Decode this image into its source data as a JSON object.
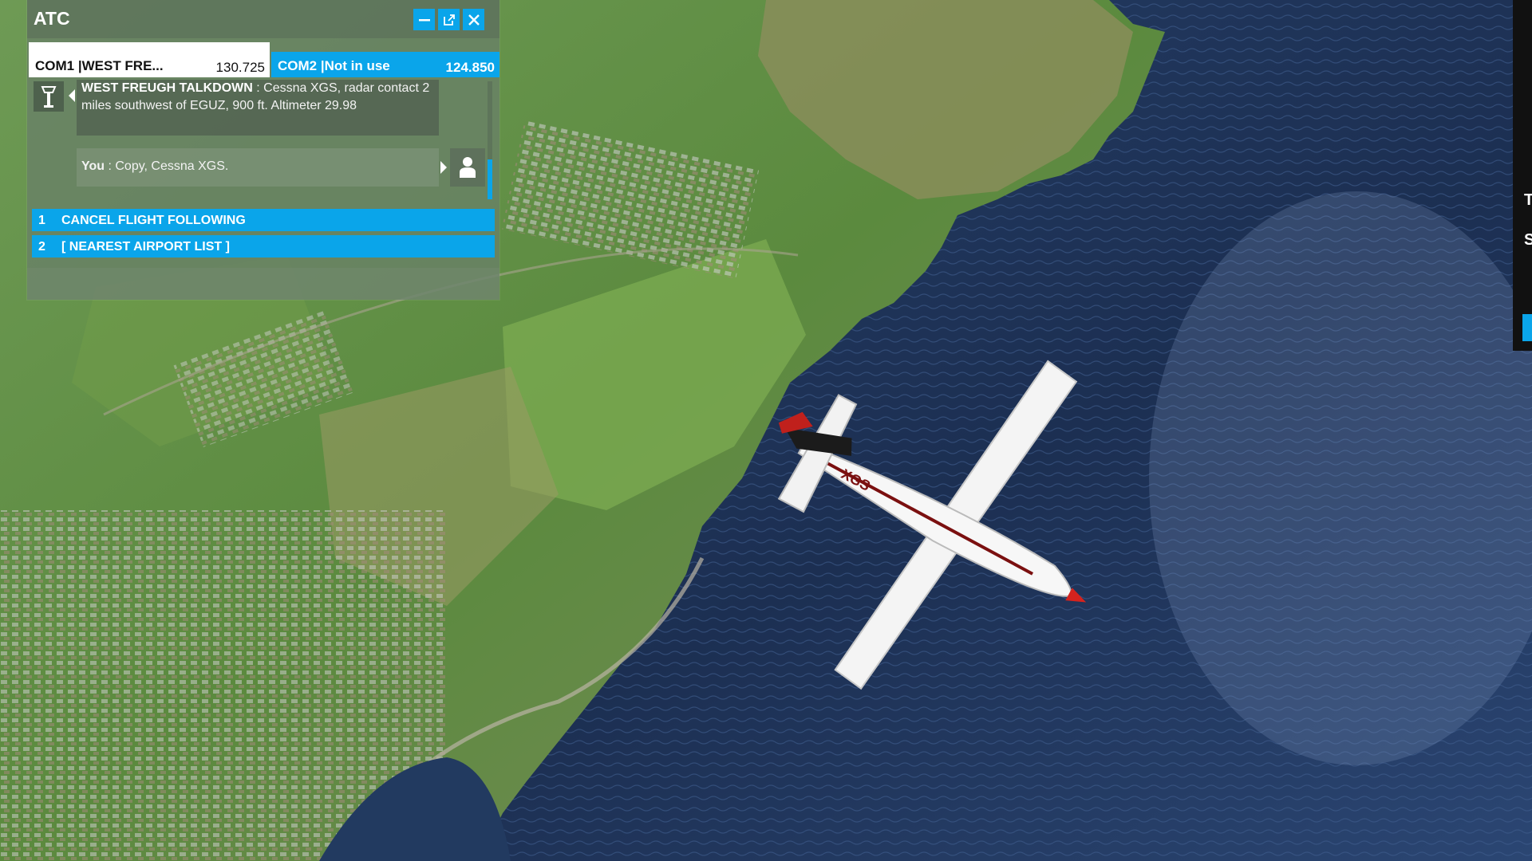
{
  "window": {
    "title": "ATC",
    "buttons": {
      "minimize": "minimize-icon",
      "popout": "popout-icon",
      "close": "close-icon"
    }
  },
  "tabs": [
    {
      "label": "COM1 |WEST FRE...",
      "frequency": "130.725",
      "active": true
    },
    {
      "label": "COM2 |Not in use",
      "frequency": "124.850",
      "active": false
    }
  ],
  "messages": [
    {
      "speaker": "WEST FREUGH TALKDOWN",
      "text": " : Cessna XGS, radar contact 2 miles southwest of EGUZ, 900 ft. Altimeter 29.98"
    },
    {
      "speaker": "You",
      "text": " : Copy, Cessna XGS."
    }
  ],
  "options": [
    {
      "num": "1",
      "label": "CANCEL FLIGHT FOLLOWING"
    },
    {
      "num": "2",
      "label": "[ NEAREST AIRPORT LIST ]"
    }
  ],
  "aircraft": {
    "registration": "XGS"
  },
  "edge_panel": {
    "letter_1": "T",
    "letter_2": "S"
  },
  "colors": {
    "accent": "#0aa5ea",
    "sea": "#1d3152",
    "land": "#5f8a45"
  }
}
